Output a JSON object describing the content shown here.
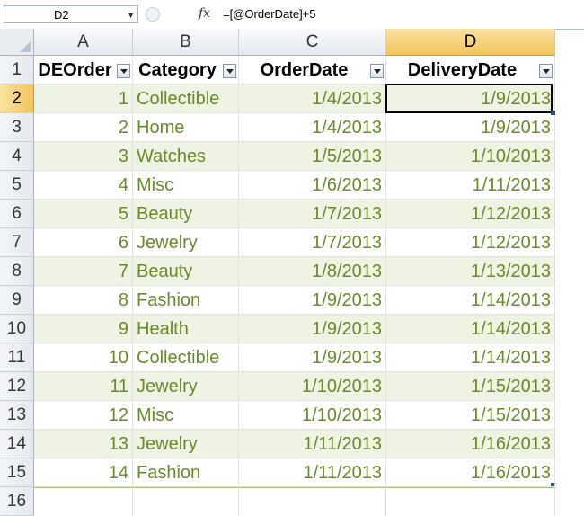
{
  "formula_bar": {
    "name_box": "D2",
    "fx_label": "fx",
    "formula": "=[@OrderDate]+5"
  },
  "columns": [
    "A",
    "B",
    "C",
    "D"
  ],
  "selected_column": "D",
  "row_numbers": [
    "1",
    "2",
    "3",
    "4",
    "5",
    "6",
    "7",
    "8",
    "9",
    "10",
    "11",
    "12",
    "13",
    "14",
    "15",
    "16"
  ],
  "selected_row": "2",
  "table": {
    "headers": [
      "DEOrder",
      "Category",
      "OrderDate",
      "DeliveryDate"
    ],
    "rows": [
      [
        "1",
        "Collectible",
        "1/4/2013",
        "1/9/2013"
      ],
      [
        "2",
        "Home",
        "1/4/2013",
        "1/9/2013"
      ],
      [
        "3",
        "Watches",
        "1/5/2013",
        "1/10/2013"
      ],
      [
        "4",
        "Misc",
        "1/6/2013",
        "1/11/2013"
      ],
      [
        "5",
        "Beauty",
        "1/7/2013",
        "1/12/2013"
      ],
      [
        "6",
        "Jewelry",
        "1/7/2013",
        "1/12/2013"
      ],
      [
        "7",
        "Beauty",
        "1/8/2013",
        "1/13/2013"
      ],
      [
        "8",
        "Fashion",
        "1/9/2013",
        "1/14/2013"
      ],
      [
        "9",
        "Health",
        "1/9/2013",
        "1/14/2013"
      ],
      [
        "10",
        "Collectible",
        "1/9/2013",
        "1/14/2013"
      ],
      [
        "11",
        "Jewelry",
        "1/10/2013",
        "1/15/2013"
      ],
      [
        "12",
        "Misc",
        "1/10/2013",
        "1/15/2013"
      ],
      [
        "13",
        "Jewelry",
        "1/11/2013",
        "1/16/2013"
      ],
      [
        "14",
        "Fashion",
        "1/11/2013",
        "1/16/2013"
      ]
    ]
  },
  "colors": {
    "band": "#eef3e3",
    "cell_text": "#6a8a2a",
    "selected_header": "#f2c45a"
  }
}
